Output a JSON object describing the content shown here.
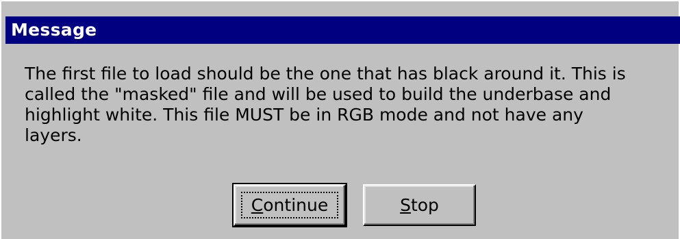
{
  "dialog": {
    "title": "Message",
    "message_lines": [
      "The first file to load should be the one that has black around it.  This is",
      "called the \"masked\" file and will be used to build the underbase and",
      "highlight white.  This file MUST be in RGB mode and not have any",
      "layers."
    ],
    "buttons": {
      "continue": {
        "mnemonic": "C",
        "rest": "ontinue",
        "default": true
      },
      "stop": {
        "mnemonic": "S",
        "rest": "top",
        "default": false
      }
    }
  },
  "colors": {
    "titlebar": "#000080",
    "face": "#c0c0c0",
    "title_text": "#ffffff"
  }
}
